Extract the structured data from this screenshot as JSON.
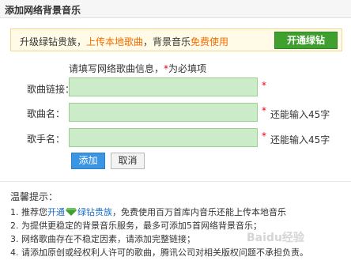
{
  "window": {
    "title": "添加网络背景音乐"
  },
  "promo": {
    "prefix": "升级绿钻贵族，",
    "highlight1": "上传本地歌曲",
    "middle": "，背景音乐",
    "highlight2": "免费使用",
    "button": "开通绿钻"
  },
  "form": {
    "hint": "请填写网络歌曲信息，",
    "hint_required_star": "*",
    "hint_required_text": "为必填项",
    "fields": [
      {
        "label": "歌曲链接：",
        "value": "",
        "required": "*",
        "counter": ""
      },
      {
        "label": "歌曲名：",
        "value": "",
        "required": "*",
        "counter": "还能输入45字"
      },
      {
        "label": "歌手名：",
        "value": "",
        "required": "*",
        "counter": "还能输入45字"
      }
    ],
    "add_button": "添加",
    "cancel_button": "取消"
  },
  "tips": {
    "title": "温馨提示：",
    "tip1_a": "1. 推荐您",
    "tip1_link1": "开通",
    "tip1_link2": "绿钻贵族",
    "tip1_b": "，免费使用百万首库内音乐还能上传本地音乐",
    "tip2": "2. 为提供更稳定的背景音乐服务，最多可添加5首网络背景音乐；",
    "tip3": "3. 网络歌曲存在不稳定因素，请添加完整链接；",
    "tip4": "4. 请添加原创或经权利人许可的歌曲，腾讯公司对相关版权问题不承担负责。"
  },
  "watermark": "Baidu经验",
  "colors": {
    "accent_green": "#3f9f2f",
    "field_bg": "#ccebc9",
    "required_red": "#e60012",
    "promo_orange": "#f56a00",
    "link_blue": "#1a6fc9"
  }
}
